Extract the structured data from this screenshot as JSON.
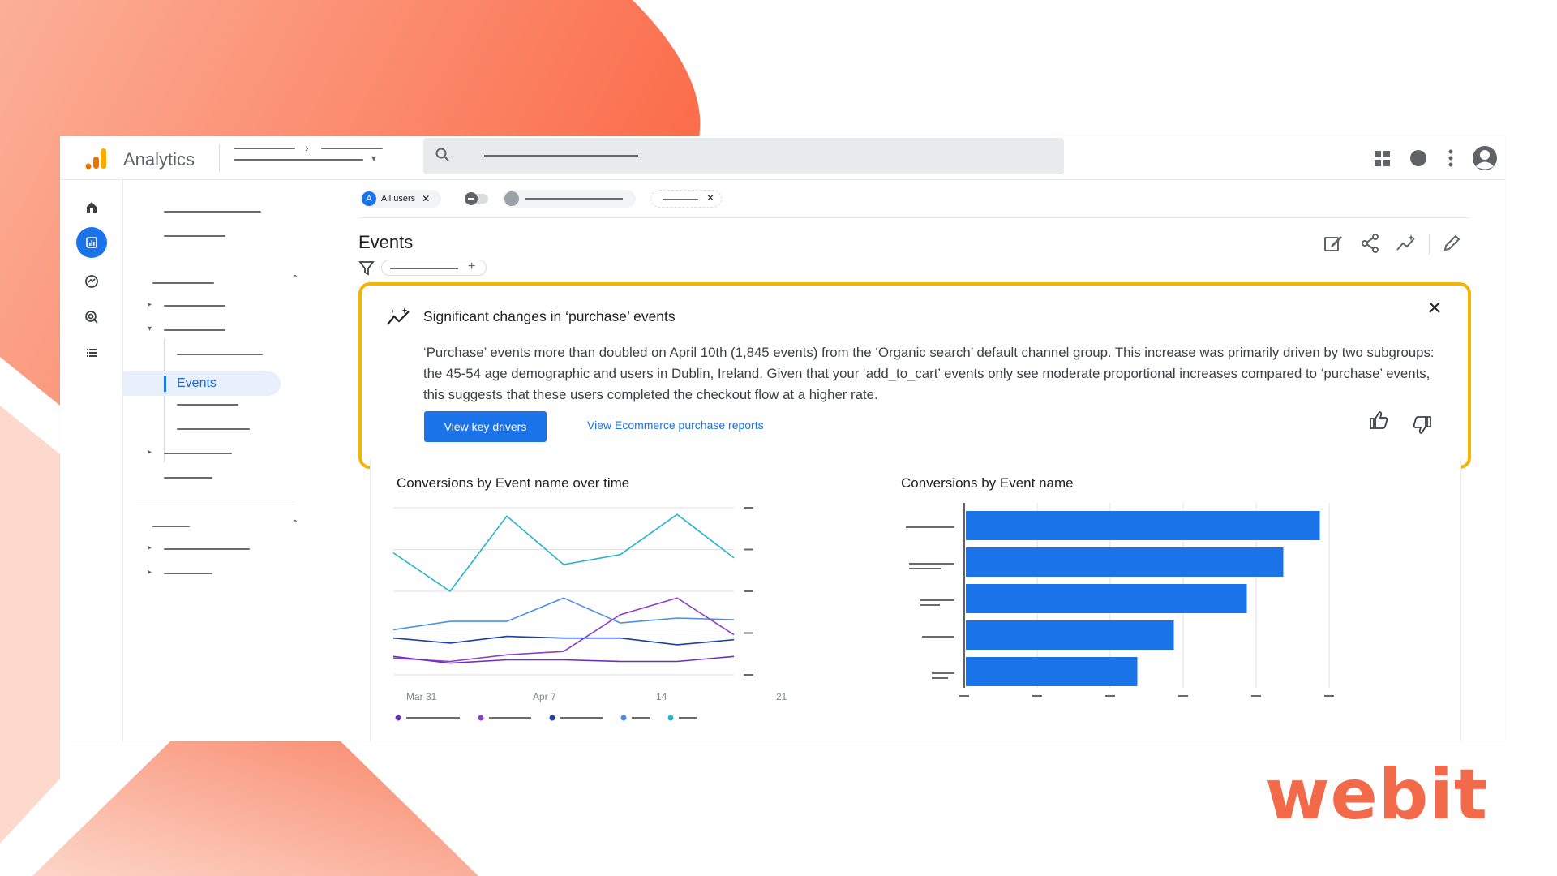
{
  "app": {
    "name": "Analytics",
    "accent": "#1a73e8",
    "logo_colors": [
      "#f9ab00",
      "#e37400"
    ]
  },
  "brand_mark": "webit",
  "brand_color": "#f26a4a",
  "topbar": {
    "icons": [
      "search-icon",
      "apps-grid-icon",
      "account-circle-icon",
      "more-vert-icon",
      "profile-avatar-icon"
    ]
  },
  "filters": {
    "comparison_chip": {
      "badge": "A",
      "label": "All users"
    }
  },
  "sidebar": {
    "rail_icons": [
      "home-icon",
      "reports-icon",
      "explore-icon",
      "advertising-icon",
      "list-icon"
    ],
    "active_item": "Events"
  },
  "page": {
    "title": "Events",
    "header_icons": [
      "edit-comparisons-icon",
      "share-icon",
      "insights-icon",
      "customize-pencil-icon"
    ]
  },
  "insight": {
    "title": "Significant changes in ‘purchase’ events",
    "body": "‘Purchase’ events more than doubled on April 10th (1,845 events) from the ‘Organic search’ default channel group. This increase was primarily driven by two subgroups: the 45-54 age demographic and users in Dublin, Ireland. Given that your ‘add_to_cart’ events only see moderate proportional increases compared to ‘purchase’ events, this suggests that these users completed the checkout flow at a higher rate.",
    "primary_button": "View key drivers",
    "secondary_link": "View Ecommerce purchase reports",
    "highlight_color": "#f4b400"
  },
  "chart_data": [
    {
      "type": "line",
      "title": "Conversions by Event name over time",
      "x": [
        0,
        1,
        2,
        3,
        4,
        5
      ],
      "x_tick_labels": [
        "Mar 31",
        "Apr 7",
        "14",
        "21"
      ],
      "ylim": [
        0,
        100
      ],
      "grid": true,
      "legend": "bottom",
      "series": [
        {
          "color": "#26b4cc",
          "values": [
            73,
            50,
            95,
            66,
            72,
            96,
            70
          ]
        },
        {
          "color": "#4f8fe8",
          "values": [
            27,
            32,
            32,
            46,
            31,
            34,
            33
          ]
        },
        {
          "color": "#8e3ec7",
          "values": [
            10,
            8,
            12,
            14,
            36,
            46,
            24
          ]
        },
        {
          "color": "#1c3fa8",
          "values": [
            22,
            19,
            23,
            22,
            22,
            18,
            21
          ]
        },
        {
          "color": "#6c2fc1",
          "values": [
            11,
            7,
            9,
            9,
            8,
            8,
            11
          ]
        }
      ]
    },
    {
      "type": "bar",
      "orientation": "horizontal",
      "title": "Conversions by Event name",
      "values": [
        97,
        87,
        77,
        57,
        47
      ],
      "xlim": [
        0,
        100
      ],
      "grid": true,
      "color": "#1a73e8"
    }
  ]
}
